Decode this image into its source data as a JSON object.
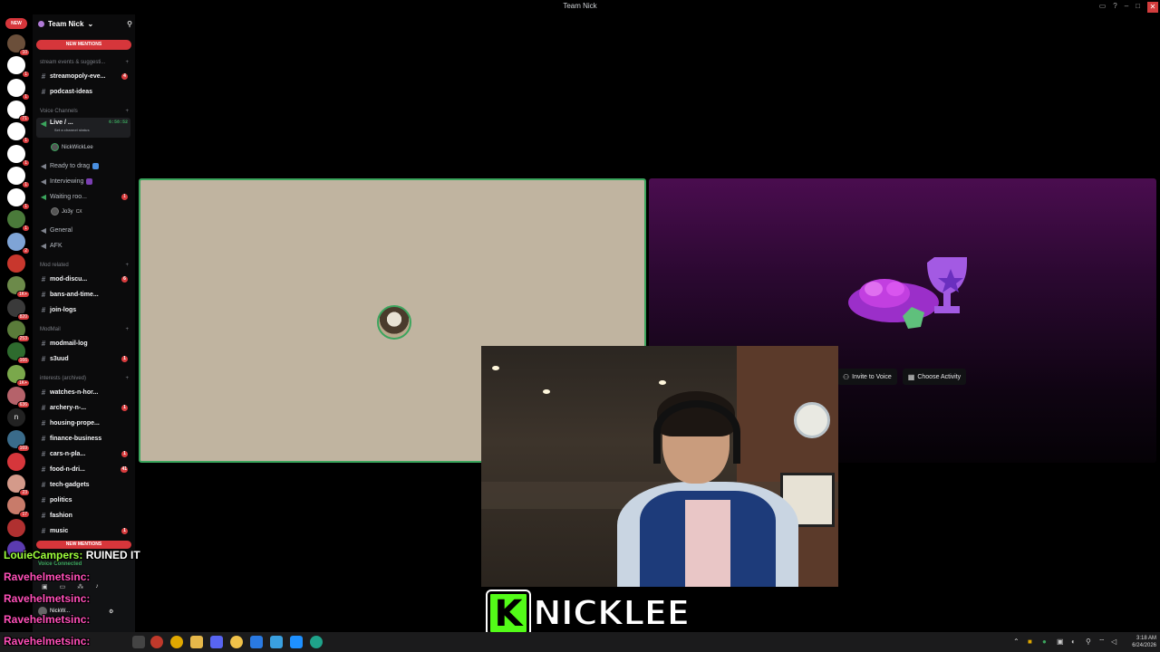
{
  "window": {
    "title": "Team Nick"
  },
  "rail": {
    "new_label": "NEW",
    "servers": [
      {
        "color": "#6b4f3a",
        "badge": "10"
      },
      {
        "color": "#ffffff",
        "badge": "1"
      },
      {
        "color": "#ffffff",
        "badge": "1"
      },
      {
        "color": "#ffffff",
        "badge": "71"
      },
      {
        "color": "#ffffff",
        "badge": "1"
      },
      {
        "color": "#ffffff",
        "badge": "1"
      },
      {
        "color": "#ffffff",
        "badge": "1"
      },
      {
        "color": "#ffffff",
        "badge": "1"
      },
      {
        "color": "#4a7a3a",
        "badge": "1"
      },
      {
        "color": "#7fa4d6",
        "badge": "2"
      },
      {
        "color": "#c8372d",
        "badge": ""
      },
      {
        "color": "#6c8a4a",
        "badge": "1K+"
      },
      {
        "color": "#3a3a3a",
        "badge": "820"
      },
      {
        "color": "#5a7c3a",
        "badge": "253"
      },
      {
        "color": "#2e6b2e",
        "badge": "166"
      },
      {
        "color": "#7aa84b",
        "badge": "1K+"
      },
      {
        "color": "#b5626a",
        "badge": "636"
      },
      {
        "color": "#222222",
        "badge": "",
        "letter": "n"
      },
      {
        "color": "#3a6b8a",
        "badge": "169"
      },
      {
        "color": "#d6363b",
        "badge": ""
      },
      {
        "color": "#d49a8a",
        "badge": "23"
      },
      {
        "color": "#c87b6a",
        "badge": "17"
      },
      {
        "color": "#b03030",
        "badge": ""
      },
      {
        "color": "#5b3bb0",
        "badge": ""
      }
    ]
  },
  "sidebar": {
    "server_name": "Team Nick",
    "new_mentions": "NEW MENTIONS",
    "cat_stream": "stream events & suggesti...",
    "ch_streamopoly": {
      "label": "streamopoly-eve...",
      "count": "4"
    },
    "ch_podcast": {
      "label": "podcast-ideas"
    },
    "cat_voice": "Voice Channels",
    "ch_live": {
      "label": "Live / ...",
      "timer": "6:58:52",
      "status": "Set a channel status"
    },
    "member_nick": "NickWickLee",
    "ch_ready": {
      "label": "Ready to drag"
    },
    "ch_interviewing": {
      "label": "Interviewing"
    },
    "ch_waiting": {
      "label": "Waiting roo...",
      "count": "1"
    },
    "member_jo": "Jo3y",
    "member_jo_tag": "CX",
    "ch_general": {
      "label": "General"
    },
    "ch_afk": {
      "label": "AFK"
    },
    "cat_mod": "Mod related",
    "ch_mod_disc": {
      "label": "mod-discu...",
      "count": "6"
    },
    "ch_bans": {
      "label": "bans-and-time..."
    },
    "ch_join": {
      "label": "join-logs"
    },
    "cat_modmail": "ModMail",
    "ch_modmail_log": {
      "label": "modmail-log"
    },
    "ch_s3uud": {
      "label": "s3uud",
      "count": "1"
    },
    "cat_interests": "interests (archived)",
    "ch_watches": {
      "label": "watches-n-hor..."
    },
    "ch_archery": {
      "label": "archery-n-...",
      "count": "1"
    },
    "ch_housing": {
      "label": "housing-prope..."
    },
    "ch_finance": {
      "label": "finance-business"
    },
    "ch_cars": {
      "label": "cars-n-pla...",
      "count": "1"
    },
    "ch_food": {
      "label": "food-n-dri...",
      "count": "41"
    },
    "ch_tech": {
      "label": "tech-gadgets"
    },
    "ch_politics": {
      "label": "politics"
    },
    "ch_fashion": {
      "label": "fashion"
    },
    "ch_music": {
      "label": "music",
      "count": "1"
    },
    "new_mentions_bottom": "NEW MENTIONS"
  },
  "voice_panel": {
    "status": "Voice Connected",
    "user": "NickW..."
  },
  "stage": {
    "invite_label": "Invite to Voice",
    "activity_label": "Choose Activity"
  },
  "stream_overlay": {
    "logo_letter": "K",
    "streamer_name": "NICKLEE",
    "chat": [
      {
        "user": "LouieCampers:",
        "message": "RUINED IT",
        "user_color": "#9dff3b"
      },
      {
        "user": "Ravehelmetsinc:",
        "message": "",
        "user_color": "#ff4fb8"
      },
      {
        "user": "Ravehelmetsinc:",
        "message": "",
        "user_color": "#ff4fb8"
      },
      {
        "user": "Ravehelmetsinc:",
        "message": "",
        "user_color": "#ff4fb8"
      },
      {
        "user": "Ravehelmetsinc:",
        "message": "",
        "user_color": "#ff4fb8"
      }
    ]
  },
  "taskbar": {
    "time": "3:18 AM",
    "date": "6/24/2026"
  },
  "colors": {
    "accent_green": "#3ba55d",
    "mention_red": "#d6363b",
    "kick_green": "#53fc18"
  }
}
